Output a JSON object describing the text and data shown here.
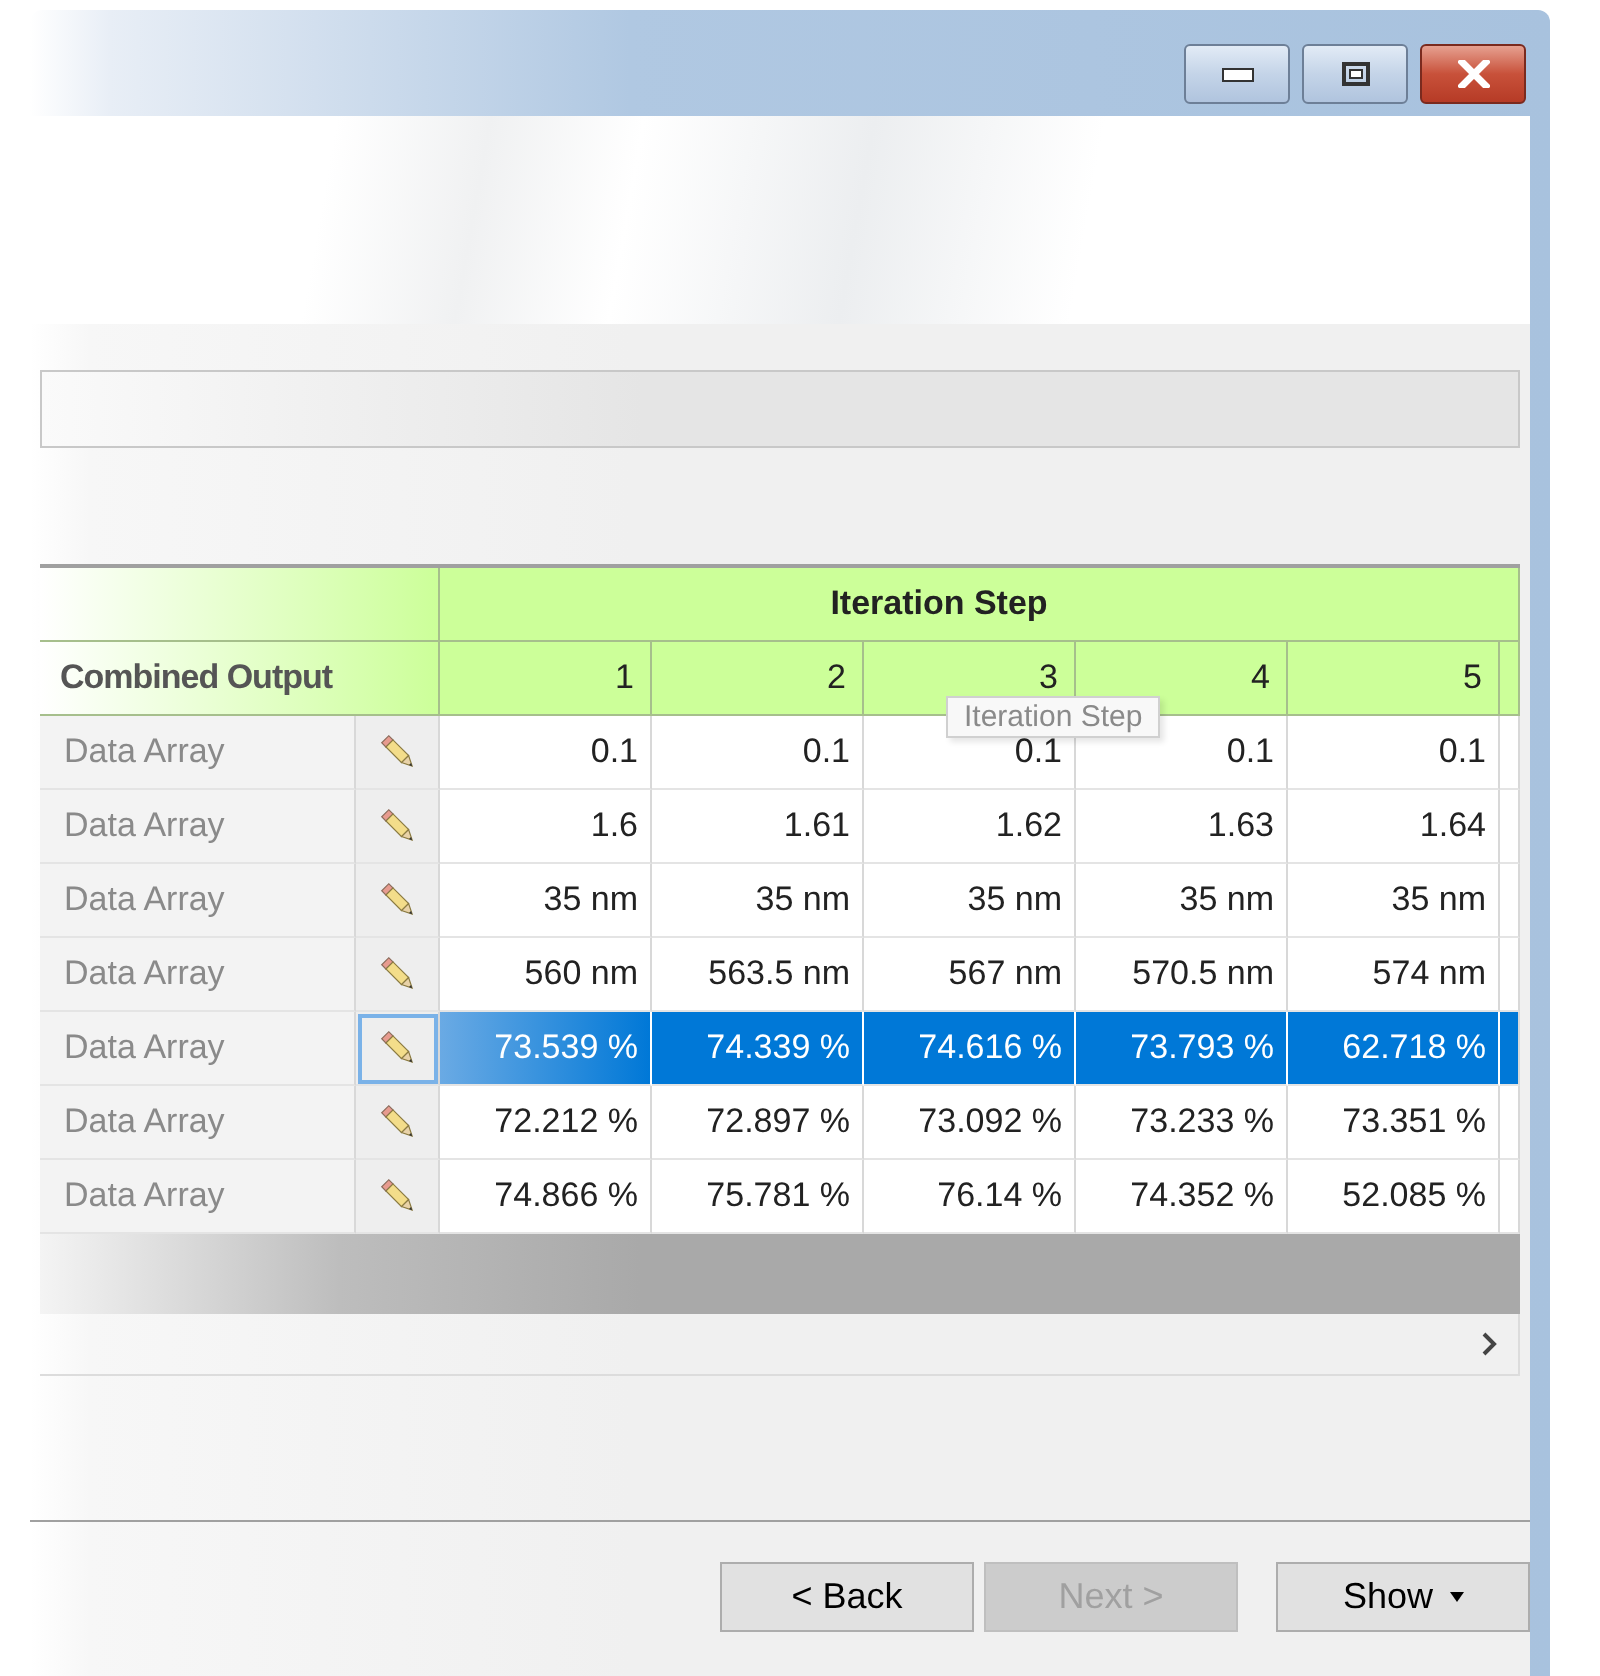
{
  "grid": {
    "group_header": "Iteration Step",
    "row_header_title": "Combined Output",
    "columns": [
      "1",
      "2",
      "3",
      "4",
      "5"
    ],
    "rows": [
      {
        "label": "Data Array",
        "selected": false,
        "cells": [
          "0.1",
          "0.1",
          "0.1",
          "0.1",
          "0.1"
        ]
      },
      {
        "label": "Data Array",
        "selected": false,
        "cells": [
          "1.6",
          "1.61",
          "1.62",
          "1.63",
          "1.64"
        ]
      },
      {
        "label": "Data Array",
        "selected": false,
        "cells": [
          "35 nm",
          "35 nm",
          "35 nm",
          "35 nm",
          "35 nm"
        ]
      },
      {
        "label": "Data Array",
        "selected": false,
        "cells": [
          "560 nm",
          "563.5 nm",
          "567 nm",
          "570.5 nm",
          "574 nm"
        ]
      },
      {
        "label": "Data Array",
        "selected": true,
        "cells": [
          "73.539 %",
          "74.339 %",
          "74.616 %",
          "73.793 %",
          "62.718 %"
        ]
      },
      {
        "label": "Data Array",
        "selected": false,
        "cells": [
          "72.212 %",
          "72.897 %",
          "73.092 %",
          "73.233 %",
          "73.351 %"
        ]
      },
      {
        "label": "Data Array",
        "selected": false,
        "cells": [
          "74.866 %",
          "75.781 %",
          "76.14 %",
          "74.352 %",
          "52.085 %"
        ]
      }
    ]
  },
  "tooltip": {
    "text": "Iteration Step"
  },
  "buttons": [
    {
      "label": "< Back",
      "disabled": false,
      "kind": "plain"
    },
    {
      "label": "Next >",
      "disabled": true,
      "kind": "plain"
    },
    {
      "label": "Show",
      "disabled": false,
      "kind": "dropdown"
    }
  ]
}
